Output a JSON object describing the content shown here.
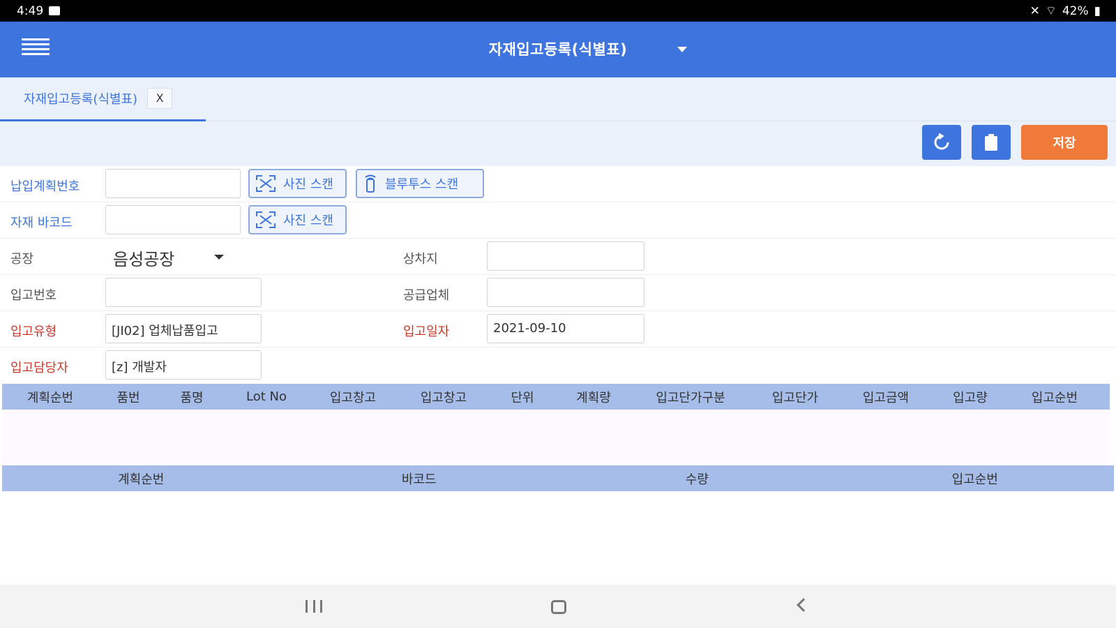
{
  "status_bar": {
    "time": "4:49",
    "battery": "42%"
  },
  "app_bar": {
    "title": "자재입고등록(식별표)"
  },
  "tabs": [
    {
      "label": "자재입고등록(식별표)",
      "close_label": "X"
    }
  ],
  "toolbar": {
    "save_label": "저장"
  },
  "form": {
    "delivery_plan_no": {
      "label": "납입계획번호",
      "value": ""
    },
    "material_barcode": {
      "label": "자재 바코드",
      "value": ""
    },
    "photo_scan_label": "사진 스캔",
    "bluetooth_scan_label": "블루투스 스캔",
    "factory": {
      "label": "공장",
      "value": "음성공장"
    },
    "storage": {
      "label": "상차지",
      "value": ""
    },
    "receipt_no": {
      "label": "입고번호",
      "value": ""
    },
    "supplier": {
      "label": "공급업체",
      "value": ""
    },
    "receipt_type": {
      "label": "입고유형",
      "value": "[JI02] 업체납품입고"
    },
    "receipt_date": {
      "label": "입고일자",
      "value": "2021-09-10"
    },
    "receipt_manager": {
      "label": "입고담당자",
      "value": "[z] 개발자"
    }
  },
  "grid_main": {
    "columns": [
      "계획순번",
      "품번",
      "품명",
      "Lot No",
      "입고창고",
      "입고창고",
      "단위",
      "계획량",
      "입고단가구분",
      "입고단가",
      "입고금액",
      "입고량",
      "입고순번"
    ],
    "rows": []
  },
  "grid_detail": {
    "columns": [
      "계획순번",
      "바코드",
      "수량",
      "입고순번"
    ],
    "rows": []
  },
  "colors": {
    "primary": "#3e74dd",
    "save": "#ef7a3a",
    "required_label": "#c8392b",
    "grid_header": "#a6bde9"
  }
}
